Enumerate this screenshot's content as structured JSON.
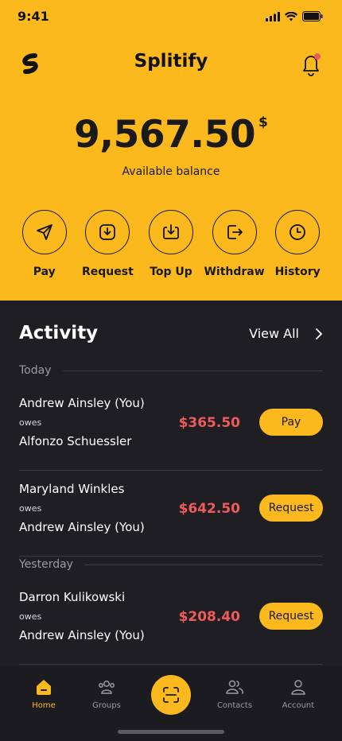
{
  "status_bar": {
    "time": "9:41"
  },
  "header": {
    "app_title": "Splitify",
    "logo_icon": "splitify-logo-icon",
    "bell_icon": "bell-icon"
  },
  "balance": {
    "amount": "9,567.50",
    "currency": "$",
    "label": "Available balance"
  },
  "actions": [
    {
      "label": "Pay",
      "icon": "send-icon"
    },
    {
      "label": "Request",
      "icon": "request-icon"
    },
    {
      "label": "Top Up",
      "icon": "top-up-icon"
    },
    {
      "label": "Withdraw",
      "icon": "withdraw-icon"
    },
    {
      "label": "History",
      "icon": "clock-icon"
    }
  ],
  "activity": {
    "title": "Activity",
    "view_all": "View All",
    "sections": [
      {
        "label": "Today",
        "rows": [
          {
            "from": "Andrew Ainsley (You)",
            "owes": "owes",
            "to": "Alfonzo Schuessler",
            "amount": "$365.50",
            "action": "Pay"
          },
          {
            "from": "Maryland Winkles",
            "owes": "owes",
            "to": "Andrew Ainsley (You)",
            "amount": "$642.50",
            "action": "Request"
          }
        ]
      },
      {
        "label": "Yesterday",
        "rows": [
          {
            "from": "Darron Kulikowski",
            "owes": "owes",
            "to": "Andrew Ainsley (You)",
            "amount": "$208.40",
            "action": "Request"
          }
        ]
      }
    ]
  },
  "nav": {
    "items": [
      {
        "label": "Home",
        "icon": "home-icon",
        "active": true
      },
      {
        "label": "Groups",
        "icon": "groups-icon"
      },
      {
        "label": "",
        "icon": "scan-icon"
      },
      {
        "label": "Contacts",
        "icon": "contacts-icon"
      },
      {
        "label": "Account",
        "icon": "account-icon"
      }
    ]
  },
  "colors": {
    "accent": "#fbb91e",
    "background": "#1f1f23",
    "negative": "#ef5a5a"
  }
}
